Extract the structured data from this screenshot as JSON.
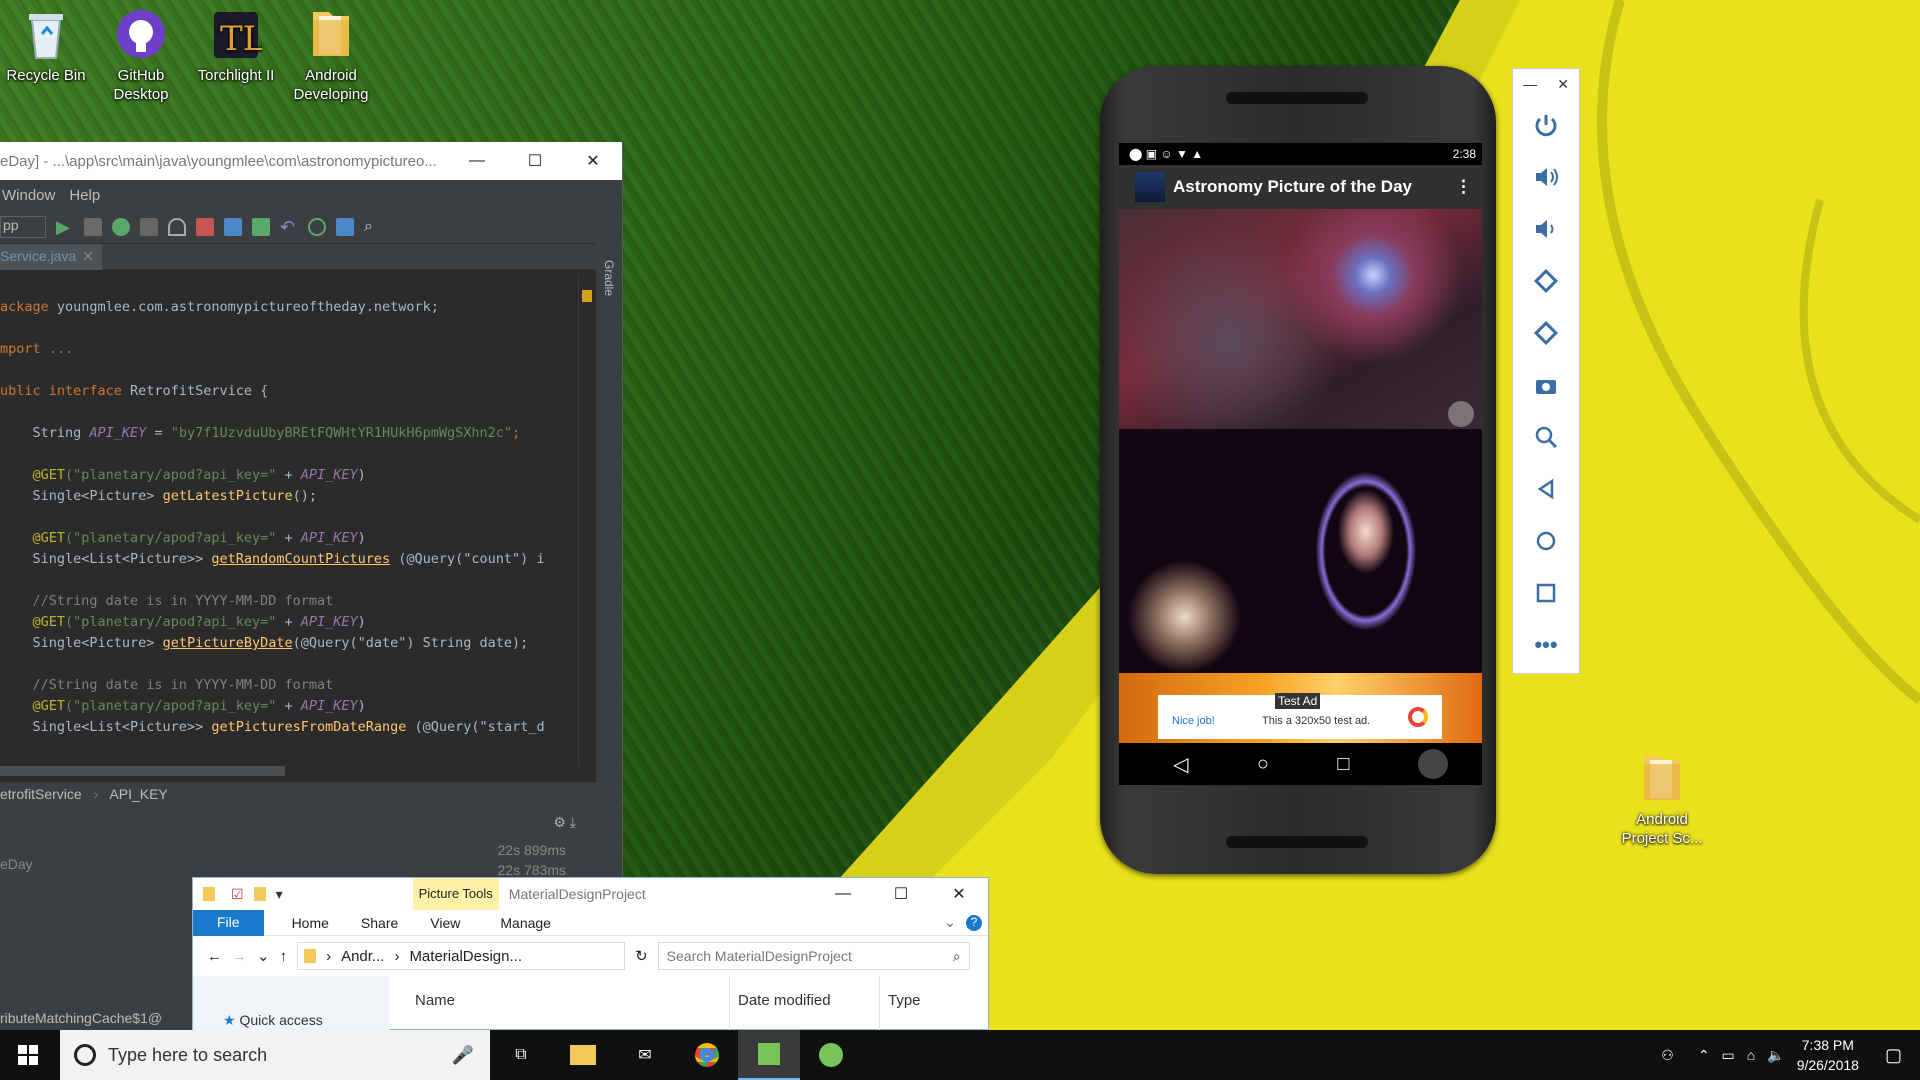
{
  "desktop": {
    "icons": [
      {
        "label": "Recycle Bin"
      },
      {
        "label": "GitHub Desktop"
      },
      {
        "label": "Torchlight II"
      },
      {
        "label": "Android Developing"
      },
      {
        "label": "Android Project Sc..."
      }
    ]
  },
  "ide": {
    "title": "eDay] - ...\\app\\src\\main\\java\\youngmlee\\com\\astronomypictureo...",
    "menu": [
      "Window",
      "Help"
    ],
    "run_config": "pp",
    "tab": "Service.java",
    "gradle_label": "Gradle",
    "breadcrumb": [
      "etrofitService",
      "API_KEY"
    ],
    "bottom_times": [
      "22s 899ms",
      "22s 783ms"
    ],
    "bottom_left": [
      "eDay",
      "ributeMatchingCache$1@"
    ],
    "code": {
      "l1_kw": "ackage",
      "l1_rest": " youngmlee.com.astronomypictureoftheday.network;",
      "l2_kw": "mport",
      "l2_rest": " ...",
      "l3_kw": "ublic interface",
      "l3_rest": " RetrofitService {",
      "l4_a": "    String ",
      "l4_b": "API_KEY",
      "l4_c": " = ",
      "l4_d": "\"by7f1UzvduUbyBREtFQWHtYR1HUkH6pmWgSXhn2c\"",
      "l4_e": ";",
      "get1_a": "    @GET",
      "get1_b": "(\"planetary/apod?api_key=\"",
      "get1_c": " + ",
      "get1_d": "API_KEY",
      "get1_e": ")",
      "m1_a": "    Single<Picture> ",
      "m1_b": "getLatestPicture",
      "m1_c": "();",
      "m2_a": "    Single<List<Picture>> ",
      "m2_b": "getRandomCountPictures",
      "m2_c": " (@Query(\"count\") i",
      "cm1": "    //String date is in YYYY-MM-DD format",
      "m3_a": "    Single<Picture> ",
      "m3_b": "getPictureByDate",
      "m3_c": "(@Query(\"date\") String date);",
      "cm2": "    //String date is in YYYY-MM-DD format",
      "m4_a": "    Single<List<Picture>> ",
      "m4_b": "getPicturesFromDateRange",
      "m4_c": " (@Query(\"start_d"
    }
  },
  "phone": {
    "time": "2:38",
    "app_title": "Astronomy Picture of the Day",
    "ad": {
      "badge": "Test Ad",
      "left": "Nice job!",
      "text": "This a 320x50 test ad."
    }
  },
  "explorer": {
    "tools_tab": "Picture Tools",
    "title": "MaterialDesignProject",
    "ribbon": [
      "File",
      "Home",
      "Share",
      "View",
      "Manage"
    ],
    "path": [
      "Andr...",
      "MaterialDesign..."
    ],
    "search_placeholder": "Search MaterialDesignProject",
    "columns": [
      "Name",
      "Date modified",
      "Type"
    ],
    "quick_access": "Quick access"
  },
  "taskbar": {
    "search_placeholder": "Type here to search",
    "time": "7:38 PM",
    "date": "9/26/2018"
  },
  "colors": {
    "accent": "#0078d7",
    "ide_bg": "#2b2b2b",
    "wheat": "#e8e21a"
  }
}
